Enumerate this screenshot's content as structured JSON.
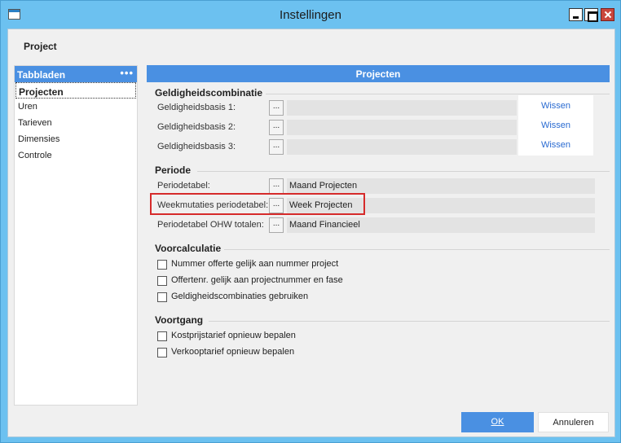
{
  "window": {
    "title": "Instellingen"
  },
  "section": {
    "title": "Project"
  },
  "sidebar": {
    "header": "Tabbladen",
    "menu_glyph": "•••",
    "items": [
      {
        "label": "Projecten",
        "active": true
      },
      {
        "label": "Uren"
      },
      {
        "label": "Tarieven"
      },
      {
        "label": "Dimensies"
      },
      {
        "label": "Controle"
      }
    ]
  },
  "panel": {
    "title": "Projecten",
    "geldigheid": {
      "title": "Geldigheidscombinatie",
      "rows": [
        {
          "label": "Geldigheidsbasis 1:",
          "value": "",
          "clear": "Wissen"
        },
        {
          "label": "Geldigheidsbasis 2:",
          "value": "",
          "clear": "Wissen"
        },
        {
          "label": "Geldigheidsbasis 3:",
          "value": "",
          "clear": "Wissen"
        }
      ]
    },
    "periode": {
      "title": "Periode",
      "rows": [
        {
          "label": "Periodetabel:",
          "value": "Maand Projecten"
        },
        {
          "label": "Weekmutaties periodetabel:",
          "value": "Week Projecten"
        },
        {
          "label": "Periodetabel OHW totalen:",
          "value": "Maand Financieel"
        }
      ]
    },
    "voorcalculatie": {
      "title": "Voorcalculatie",
      "checks": [
        {
          "label": "Nummer offerte gelijk aan nummer project",
          "checked": false
        },
        {
          "label": "Offertenr. gelijk aan projectnummer en fase",
          "checked": false
        },
        {
          "label": "Geldigheidscombinaties gebruiken",
          "checked": false
        }
      ]
    },
    "voortgang": {
      "title": "Voortgang",
      "checks": [
        {
          "label": "Kostprijstarief opnieuw bepalen",
          "checked": false
        },
        {
          "label": "Verkooptarief opnieuw bepalen",
          "checked": false
        }
      ]
    }
  },
  "browse_glyph": "...",
  "buttons": {
    "ok": "OK",
    "cancel": "Annuleren"
  },
  "colors": {
    "accent": "#4a90e2",
    "title_bar": "#6cc1f0",
    "highlight": "#d62b2b",
    "link": "#2a6bd1"
  }
}
